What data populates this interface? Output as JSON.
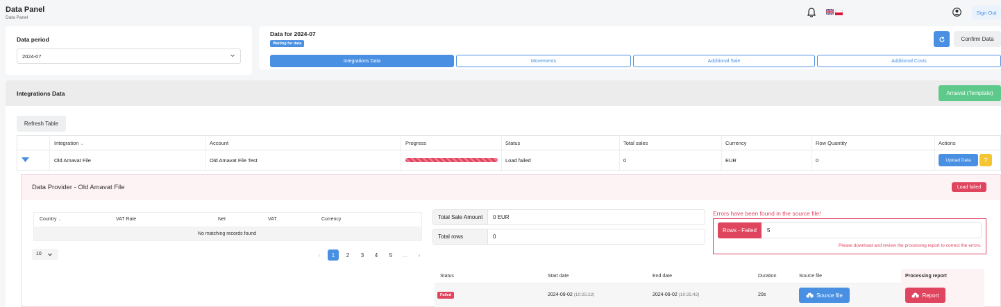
{
  "header": {
    "title": "Data Panel",
    "breadcrumb": "Data Panel",
    "sign_out": "Sign Out"
  },
  "period": {
    "label": "Data period",
    "value": "2024-07"
  },
  "data_header": {
    "title": "Data for 2024-07",
    "badge": "Waiting for data",
    "confirm": "Confirm Data"
  },
  "tabs": [
    "Integrations Data",
    "Movements",
    "Additional Sale",
    "Additional Costs"
  ],
  "section": {
    "title": "Integrations Data",
    "template_button": "Amavat (Template)",
    "refresh_button": "Refresh Table"
  },
  "table": {
    "columns": [
      "Integration",
      "Account",
      "Progress",
      "Status",
      "Total sales",
      "Currency",
      "Row Quantity",
      "Actions"
    ],
    "row": {
      "integration": "Old Amavat File",
      "account": "Old Amavat File Test",
      "progress": 1.0,
      "status": "Load failed",
      "total_sales": "0",
      "currency": "EUR",
      "row_quantity": "0",
      "upload": "Upload Data",
      "help": "?"
    }
  },
  "provider": {
    "title": "Data Provider - Old Amavat File",
    "status_badge": "Load failed",
    "inner_columns": [
      "Country",
      "VAT Rate",
      "Net",
      "VAT",
      "Currency"
    ],
    "empty": "No matching records found",
    "page_size": "10",
    "pages": [
      "1",
      "2",
      "3",
      "4",
      "5",
      "..."
    ],
    "summary": [
      {
        "label": "Total Sale Amount",
        "value": "0 EUR"
      },
      {
        "label": "Total rows",
        "value": "0"
      }
    ],
    "errors": {
      "title": "Errors have been found in the source file!",
      "rows_failed_label": "Rows - Failed",
      "rows_failed_value": "5",
      "hint": "Please download and review the processing report to correct the errors."
    },
    "processing": {
      "columns": [
        "Status",
        "Start date",
        "End date",
        "Duration",
        "Source file",
        "Processing report"
      ],
      "row": {
        "status": "Failed",
        "start_date": "2024-09-02",
        "start_time": "(10:25:22)",
        "end_date": "2024-09-02",
        "end_time": "(10:25:42)",
        "duration": "20s",
        "source_button": "Source file",
        "report_button": "Report"
      }
    }
  },
  "colors": {
    "primary": "#4a90e2",
    "danger": "#e0455f",
    "success": "#5dc98a",
    "warning": "#f4c531"
  }
}
